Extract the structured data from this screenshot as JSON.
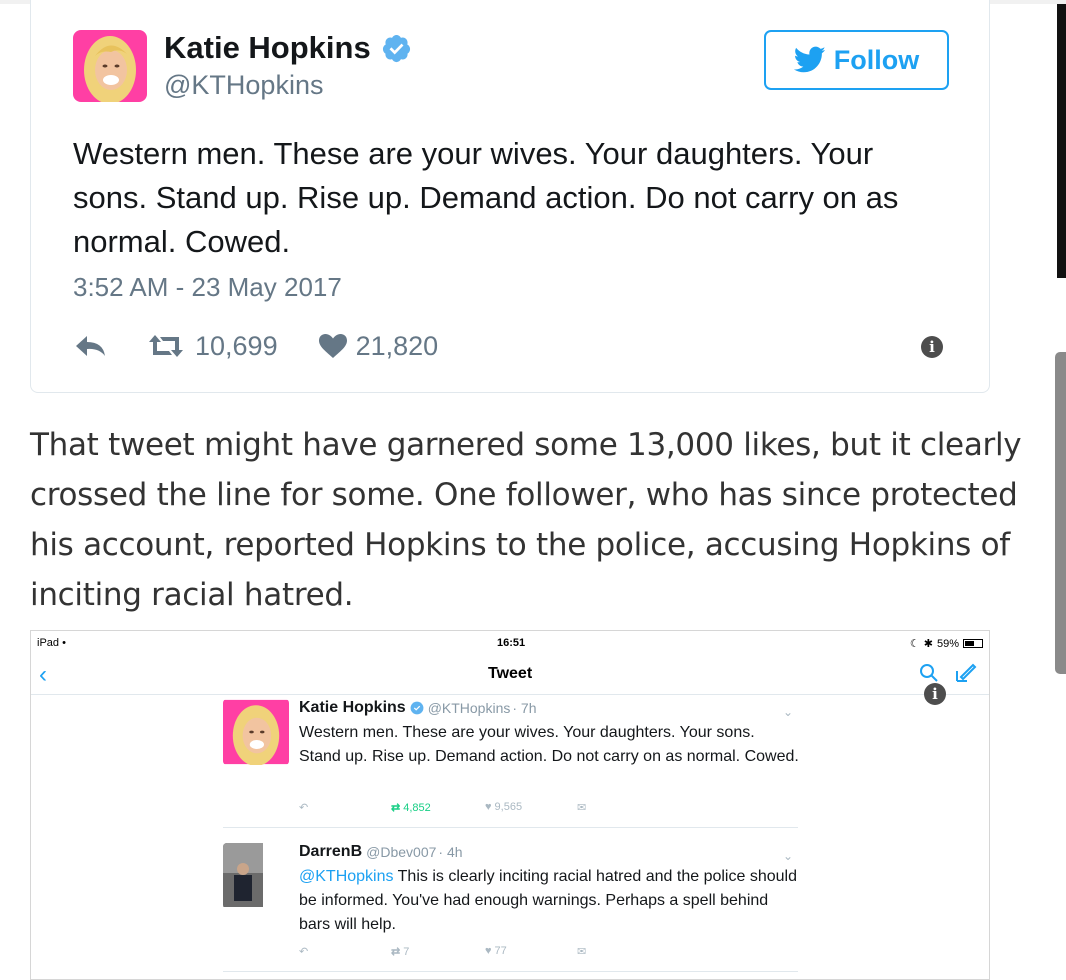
{
  "tweet": {
    "name": "Katie Hopkins",
    "handle": "@KTHopkins",
    "follow_label": "Follow",
    "text": "Western men. These are your wives. Your daughters. Your sons. Stand up. Rise up. Demand action. Do not carry on as normal. Cowed.",
    "timestamp": "3:52 AM - 23 May 2017",
    "retweets": "10,699",
    "likes": "21,820",
    "accent": "#1da1f2"
  },
  "article": {
    "paragraph": "That tweet might have garnered some 13,000 likes, but it clearly crossed the line for some. One follower, who has since protected his account, reported Hopkins to the police, accusing Hopkins of inciting racial hatred."
  },
  "ipad": {
    "status_left": "iPad",
    "time": "16:51",
    "battery": "59%",
    "battery_level": 0.59,
    "nav_title": "Tweet",
    "tweets": [
      {
        "name": "Katie Hopkins",
        "handle": "@KTHopkins",
        "age": "· 7h",
        "text": "Western men. These are your wives. Your daughters. Your sons. Stand up. Rise up. Demand action. Do not carry on as normal. Cowed.",
        "retweets": "4,852",
        "likes": "9,565"
      },
      {
        "name": "DarrenB",
        "handle": "@Dbev007",
        "age": "· 4h",
        "mention": "@KTHopkins",
        "text": " This is clearly inciting racial hatred and the police should be informed. You've had enough warnings. Perhaps a spell behind bars will help.",
        "retweets": "7",
        "likes": "77"
      }
    ]
  }
}
